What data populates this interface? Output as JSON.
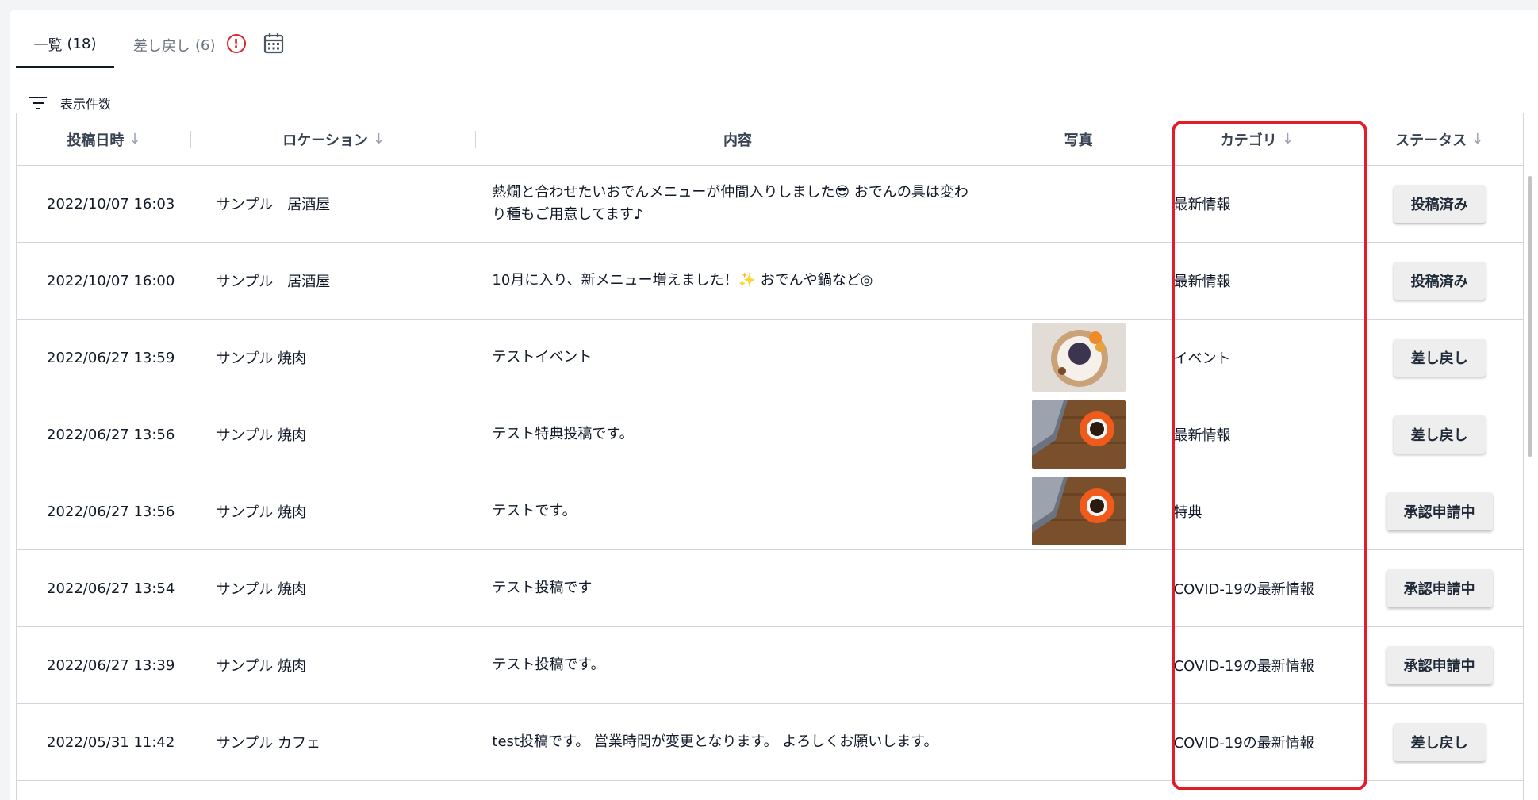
{
  "tabs": [
    {
      "label": "一覧",
      "count": "(18)"
    },
    {
      "label": "差し戻し",
      "count": "(6)"
    }
  ],
  "filter": {
    "label": "表示件数"
  },
  "table": {
    "headers": {
      "date": "投稿日時",
      "location": "ロケーション",
      "content": "内容",
      "photo": "写真",
      "category": "カテゴリ",
      "status": "ステータス"
    },
    "sort_glyph": "↓",
    "rows": [
      {
        "date": "2022/10/07 16:03",
        "location": "サンプル　居酒屋",
        "content": "熱燗と合わせたいおでんメニューが仲間入りしました😎 おでんの具は変わり種もご用意してます♪",
        "photo": "",
        "category": "最新情報",
        "status": "投稿済み"
      },
      {
        "date": "2022/10/07 16:00",
        "location": "サンプル　居酒屋",
        "content": "10月に入り、新メニュー増えました！✨ おでんや鍋など◎",
        "photo": "",
        "category": "最新情報",
        "status": "投稿済み"
      },
      {
        "date": "2022/06/27 13:59",
        "location": "サンプル 焼肉",
        "content": "テストイベント",
        "photo": "dish",
        "category": "イベント",
        "status": "差し戻し"
      },
      {
        "date": "2022/06/27 13:56",
        "location": "サンプル 焼肉",
        "content": "テスト特典投稿です。",
        "photo": "coffee",
        "category": "最新情報",
        "status": "差し戻し"
      },
      {
        "date": "2022/06/27 13:56",
        "location": "サンプル 焼肉",
        "content": "テストです。",
        "photo": "coffee",
        "category": "特典",
        "status": "承認申請中"
      },
      {
        "date": "2022/06/27 13:54",
        "location": "サンプル 焼肉",
        "content": "テスト投稿です",
        "photo": "",
        "category": "COVID-19の最新情報",
        "status": "承認申請中"
      },
      {
        "date": "2022/06/27 13:39",
        "location": "サンプル 焼肉",
        "content": "テスト投稿です。",
        "photo": "",
        "category": "COVID-19の最新情報",
        "status": "承認申請中"
      },
      {
        "date": "2022/05/31 11:42",
        "location": "サンプル カフェ",
        "content": "test投稿です。 営業時間が変更となります。 よろしくお願いします。",
        "photo": "",
        "category": "COVID-19の最新情報",
        "status": "差し戻し"
      }
    ]
  },
  "colors": {
    "accent": "#e11d2a",
    "alert": "#d9262a",
    "button_bg": "#eeeeee"
  }
}
